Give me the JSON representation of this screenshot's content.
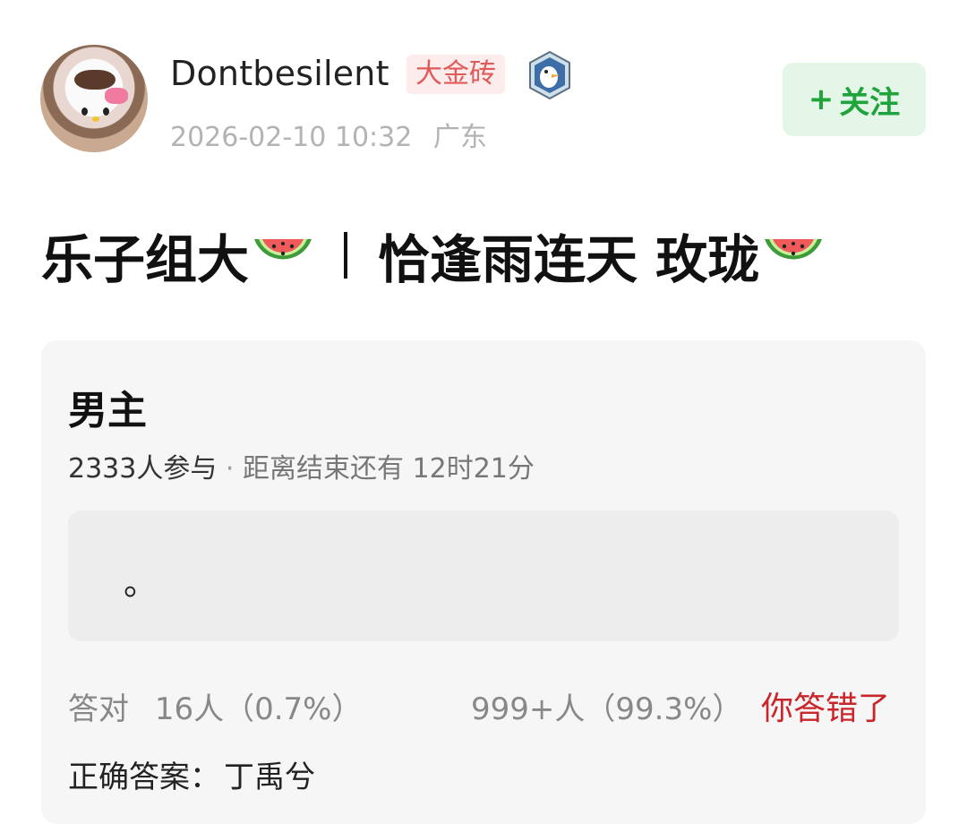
{
  "author": {
    "name": "Dontbesilent",
    "badge": "大金砖",
    "date": "2026-02-10 10:32",
    "location": "广东"
  },
  "follow": {
    "plus": "+",
    "label": "关注"
  },
  "post": {
    "title_part1": "乐子组大",
    "title_part2": "恰逢雨连天 玫珑"
  },
  "quiz": {
    "title": "男主",
    "participants": "2333人参与",
    "separator": "·",
    "time_remaining": "距离结束还有 12时21分",
    "answer_text": "。",
    "correct_label": "答对",
    "correct_count": "16人（0.7%）",
    "wrong_count": "999+人（99.3%）",
    "result": "你答错了",
    "correct_answer_label": "正确答案：",
    "correct_answer": "丁禹兮"
  },
  "colors": {
    "follow_bg": "#e3f6e8",
    "follow_text": "#1fa33b",
    "badge_bg": "#fcecec",
    "badge_text": "#e05a5a",
    "wrong_text": "#c8262a"
  },
  "icons": [
    "watermelon-icon",
    "medal-icon",
    "avatar-image"
  ]
}
